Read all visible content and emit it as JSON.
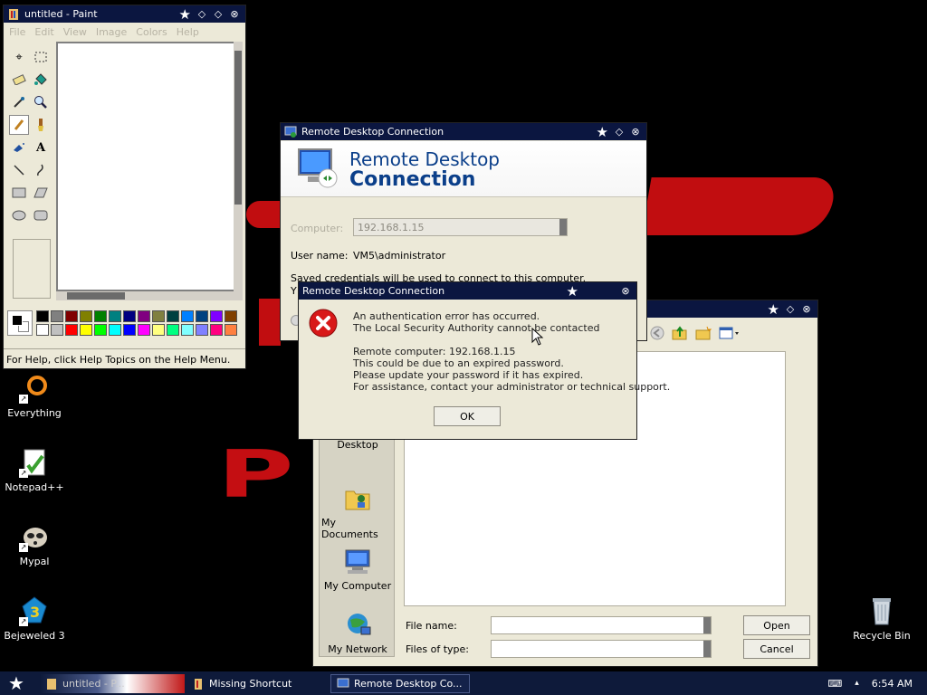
{
  "paint": {
    "title": "untitled - Paint",
    "menu": [
      "File",
      "Edit",
      "View",
      "Image",
      "Colors",
      "Help"
    ],
    "tools": [
      "free-select",
      "rect-select",
      "eraser",
      "fill",
      "color-picker",
      "magnifier",
      "pencil",
      "brush",
      "airbrush",
      "text",
      "line",
      "curve",
      "rectangle",
      "polygon",
      "ellipse",
      "rounded-rectangle"
    ],
    "palette": [
      "#000000",
      "#808080",
      "#800000",
      "#808000",
      "#008000",
      "#008080",
      "#000080",
      "#800080",
      "#808040",
      "#004040",
      "#0080ff",
      "#004080",
      "#8000ff",
      "#804000",
      "#ffffff",
      "#c0c0c0",
      "#ff0000",
      "#ffff00",
      "#00ff00",
      "#00ffff",
      "#0000ff",
      "#ff00ff",
      "#ffff80",
      "#00ff80",
      "#80ffff",
      "#8080ff",
      "#ff0080",
      "#ff8040"
    ],
    "status": "For Help, click Help Topics on the Help Menu."
  },
  "rdc": {
    "title": "Remote Desktop Connection",
    "banner_line1": "Remote Desktop",
    "banner_line2": "Connection",
    "computer_label": "Computer:",
    "computer_value": "192.168.1.15",
    "username_label": "User name:",
    "username_value": "VM5\\administrator",
    "saved_text": "Saved credentials will be used to connect to this computer.",
    "partial_text": "Y"
  },
  "error": {
    "title": "Remote Desktop Connection",
    "line1": "An authentication error has occurred.",
    "line2": "The Local Security Authority cannot be contacted",
    "line3": "Remote computer: 192.168.1.15",
    "line4": "This could be due to an expired password.",
    "line5": "Please update your password if it has expired.",
    "line6": "For assistance, contact your administrator or technical support.",
    "ok": "OK"
  },
  "open_dialog": {
    "places": [
      "Desktop",
      "My Documents",
      "My Computer",
      "My Network"
    ],
    "file_name_label": "File name:",
    "files_of_type_label": "Files of type:",
    "file_name_value": "",
    "files_of_type_value": "",
    "open": "Open",
    "cancel": "Cancel"
  },
  "desktop": {
    "icons": [
      "Everything",
      "Notepad++",
      "Mypal",
      "Bejeweled 3",
      "Recycle Bin"
    ],
    "wallpaper_text": "P"
  },
  "taskbar": {
    "tasks": [
      "untitled - P...",
      "Missing Shortcut",
      "Remote Desktop Co..."
    ],
    "time": "6:54 AM",
    "colors": {
      "bar": "#0e1a3a",
      "title": "#0b1640",
      "accent": "#c10d10"
    }
  }
}
